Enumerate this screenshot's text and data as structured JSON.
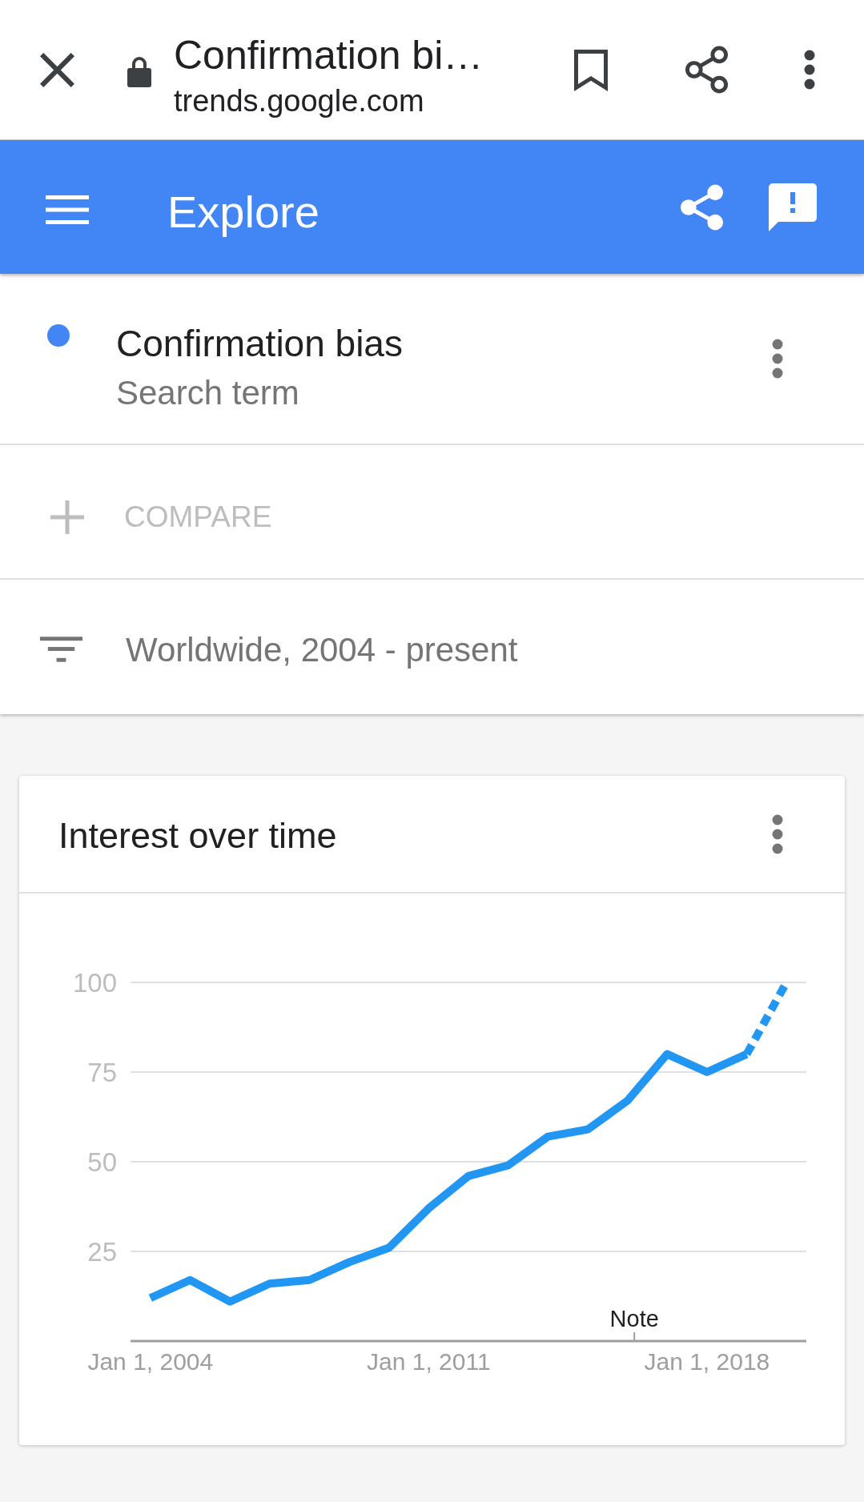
{
  "browser_bar": {
    "page_title": "Confirmation bi…",
    "url": "trends.google.com"
  },
  "app_bar": {
    "title": "Explore"
  },
  "search_terms": [
    {
      "term": "Confirmation bias",
      "type": "Search term",
      "color": "#4285f4"
    }
  ],
  "compare": {
    "placeholder": "COMPARE"
  },
  "filter": {
    "label": "Worldwide, 2004 - present"
  },
  "card": {
    "title": "Interest over time",
    "chart_data": {
      "type": "line",
      "categories": [
        "Jan 1, 2004",
        null,
        null,
        null,
        null,
        null,
        null,
        "Jan 1, 2011",
        null,
        null,
        null,
        null,
        null,
        null,
        "Jan 1, 2018",
        null,
        null
      ],
      "series": [
        {
          "color": "#2196f3",
          "line_style": "solid",
          "values": [
            12,
            17,
            11,
            16,
            17,
            22,
            26,
            37,
            46,
            49,
            57,
            59,
            67,
            80,
            75,
            80,
            null
          ]
        },
        {
          "color": "#2196f3",
          "line_style": "dashed",
          "values": [
            null,
            null,
            null,
            null,
            null,
            null,
            null,
            null,
            null,
            null,
            null,
            null,
            null,
            null,
            null,
            80,
            100
          ]
        }
      ],
      "ylim": [
        0,
        100
      ],
      "yticks": [
        25,
        50,
        75,
        100
      ],
      "grid": true,
      "annotations": [
        "Note"
      ]
    }
  }
}
